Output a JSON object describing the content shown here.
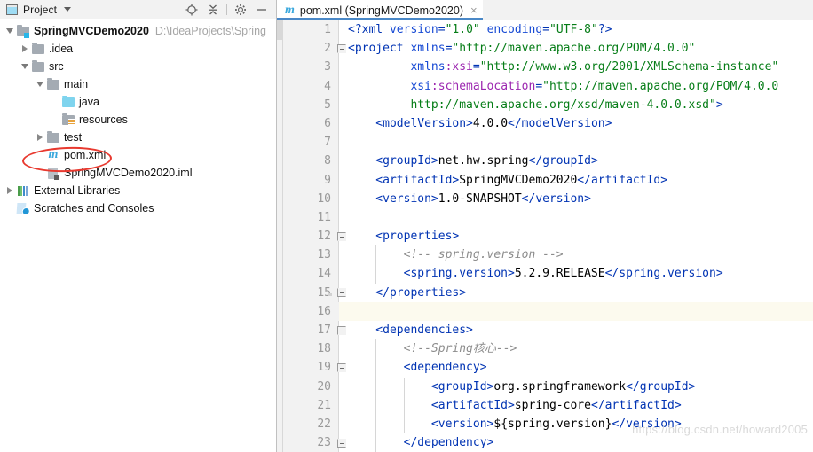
{
  "project_panel": {
    "header": {
      "title": "Project",
      "icon": "project-window-icon",
      "caret": "chevron-down-icon",
      "buttons": [
        {
          "name": "locate-icon",
          "tooltip": "Select Opened File"
        },
        {
          "name": "collapse-all-icon",
          "tooltip": "Collapse All"
        },
        {
          "name": "gear-icon",
          "tooltip": "Settings"
        },
        {
          "name": "minimize-icon",
          "tooltip": "Hide"
        }
      ]
    },
    "tree": [
      {
        "label": "SpringMVCDemo2020",
        "path": "D:\\IdeaProjects\\Spring",
        "indent": 0,
        "twisty": "down",
        "icon": "module-folder-icon",
        "bold": true
      },
      {
        "label": ".idea",
        "path": "",
        "indent": 1,
        "twisty": "right",
        "icon": "folder-icon",
        "bold": false
      },
      {
        "label": "src",
        "path": "",
        "indent": 1,
        "twisty": "down",
        "icon": "folder-icon",
        "bold": false
      },
      {
        "label": "main",
        "path": "",
        "indent": 2,
        "twisty": "down",
        "icon": "folder-icon",
        "bold": false
      },
      {
        "label": "java",
        "path": "",
        "indent": 3,
        "twisty": "none",
        "icon": "sources-folder-icon",
        "bold": false
      },
      {
        "label": "resources",
        "path": "",
        "indent": 3,
        "twisty": "none",
        "icon": "resources-folder-icon",
        "bold": false
      },
      {
        "label": "test",
        "path": "",
        "indent": 2,
        "twisty": "right",
        "icon": "folder-icon",
        "bold": false
      },
      {
        "label": "pom.xml",
        "path": "",
        "indent": 2,
        "twisty": "none",
        "icon": "maven-icon",
        "bold": false
      },
      {
        "label": "SpringMVCDemo2020.iml",
        "path": "",
        "indent": 2,
        "twisty": "none",
        "icon": "iml-file-icon",
        "bold": false
      },
      {
        "label": "External Libraries",
        "path": "",
        "indent": 0,
        "twisty": "right",
        "icon": "libraries-icon",
        "bold": false
      },
      {
        "label": "Scratches and Consoles",
        "path": "",
        "indent": 0,
        "twisty": "none",
        "icon": "scratches-icon",
        "bold": false
      }
    ],
    "annotation": {
      "shape": "ellipse",
      "color": "#e8392f",
      "target": "pom.xml"
    }
  },
  "editor": {
    "tab": {
      "icon": "maven-icon",
      "label": "pom.xml (SpringMVCDemo2020)",
      "close": "×"
    },
    "accent_color": "#4a88c7",
    "current_line": 16,
    "lines": [
      {
        "n": 1,
        "fold": "none",
        "bulb": false,
        "tokens": [
          {
            "c": "t",
            "s": "<?xml "
          },
          {
            "c": "a",
            "s": "version"
          },
          {
            "c": "t",
            "s": "="
          },
          {
            "c": "v",
            "s": "\"1.0\""
          },
          {
            "c": "t",
            "s": " "
          },
          {
            "c": "a",
            "s": "encoding"
          },
          {
            "c": "t",
            "s": "="
          },
          {
            "c": "v",
            "s": "\"UTF-8\""
          },
          {
            "c": "t",
            "s": "?>"
          }
        ],
        "indent": 4
      },
      {
        "n": 2,
        "fold": "open",
        "bulb": false,
        "tokens": [
          {
            "c": "t",
            "s": "<project "
          },
          {
            "c": "a",
            "s": "xmlns"
          },
          {
            "c": "t",
            "s": "="
          },
          {
            "c": "v",
            "s": "\"http://maven.apache.org/POM/4.0.0\""
          }
        ],
        "indent": 2
      },
      {
        "n": 3,
        "fold": "none",
        "bulb": false,
        "tokens": [
          {
            "c": "a",
            "s": "         xmlns"
          },
          {
            "c": "ns",
            "s": ":xsi"
          },
          {
            "c": "t",
            "s": "="
          },
          {
            "c": "v",
            "s": "\"http://www.w3.org/2001/XMLSchema-instance\""
          }
        ],
        "indent": 2
      },
      {
        "n": 4,
        "fold": "none",
        "bulb": false,
        "tokens": [
          {
            "c": "a",
            "s": "         xsi"
          },
          {
            "c": "ns",
            "s": ":schemaLocation"
          },
          {
            "c": "t",
            "s": "="
          },
          {
            "c": "v",
            "s": "\"http://maven.apache.org/POM/4.0.0"
          }
        ],
        "indent": 2
      },
      {
        "n": 5,
        "fold": "none",
        "bulb": false,
        "tokens": [
          {
            "c": "v",
            "s": "         http://maven.apache.org/xsd/maven-4.0.0.xsd\""
          },
          {
            "c": "t",
            "s": ">"
          }
        ],
        "indent": 2
      },
      {
        "n": 6,
        "fold": "none",
        "bulb": false,
        "tokens": [
          {
            "c": "t",
            "s": "    <modelVersion>"
          },
          {
            "c": "txt",
            "s": "4.0.0"
          },
          {
            "c": "t",
            "s": "</modelVersion>"
          }
        ],
        "indent": 4
      },
      {
        "n": 7,
        "fold": "none",
        "bulb": false,
        "tokens": [],
        "indent": 4
      },
      {
        "n": 8,
        "fold": "none",
        "bulb": false,
        "tokens": [
          {
            "c": "t",
            "s": "    <groupId>"
          },
          {
            "c": "txt",
            "s": "net.hw.spring"
          },
          {
            "c": "t",
            "s": "</groupId>"
          }
        ],
        "indent": 4
      },
      {
        "n": 9,
        "fold": "none",
        "bulb": false,
        "tokens": [
          {
            "c": "t",
            "s": "    <artifactId>"
          },
          {
            "c": "txt",
            "s": "SpringMVCDemo2020"
          },
          {
            "c": "t",
            "s": "</artifactId>"
          }
        ],
        "indent": 4
      },
      {
        "n": 10,
        "fold": "none",
        "bulb": false,
        "tokens": [
          {
            "c": "t",
            "s": "    <version>"
          },
          {
            "c": "txt",
            "s": "1.0-SNAPSHOT"
          },
          {
            "c": "t",
            "s": "</version>"
          }
        ],
        "indent": 4
      },
      {
        "n": 11,
        "fold": "none",
        "bulb": false,
        "tokens": [],
        "indent": 4
      },
      {
        "n": 12,
        "fold": "open",
        "bulb": false,
        "tokens": [
          {
            "c": "t",
            "s": "    <properties>"
          }
        ],
        "indent": 4
      },
      {
        "n": 13,
        "fold": "none",
        "bulb": false,
        "tokens": [
          {
            "c": "cm",
            "s": "        <!-- spring.version -->"
          }
        ],
        "indent": 4
      },
      {
        "n": 14,
        "fold": "none",
        "bulb": false,
        "tokens": [
          {
            "c": "t",
            "s": "        <spring.version>"
          },
          {
            "c": "txt",
            "s": "5.2.9.RELEASE"
          },
          {
            "c": "t",
            "s": "</spring.version>"
          }
        ],
        "indent": 4
      },
      {
        "n": 15,
        "fold": "close",
        "bulb": true,
        "tokens": [
          {
            "c": "t",
            "s": "    </properties>"
          }
        ],
        "indent": 4
      },
      {
        "n": 16,
        "fold": "none",
        "bulb": false,
        "tokens": [],
        "indent": 4
      },
      {
        "n": 17,
        "fold": "open",
        "bulb": false,
        "tokens": [
          {
            "c": "t",
            "s": "    <dependencies>"
          }
        ],
        "indent": 4
      },
      {
        "n": 18,
        "fold": "none",
        "bulb": false,
        "tokens": [
          {
            "c": "cm",
            "s": "        <!--Spring核心-->"
          }
        ],
        "indent": 4
      },
      {
        "n": 19,
        "fold": "open",
        "bulb": false,
        "tokens": [
          {
            "c": "t",
            "s": "        <dependency>"
          }
        ],
        "indent": 8
      },
      {
        "n": 20,
        "fold": "none",
        "bulb": false,
        "tokens": [
          {
            "c": "t",
            "s": "            <groupId>"
          },
          {
            "c": "txt",
            "s": "org.springframework"
          },
          {
            "c": "t",
            "s": "</groupId>"
          }
        ],
        "indent": 8
      },
      {
        "n": 21,
        "fold": "none",
        "bulb": false,
        "tokens": [
          {
            "c": "t",
            "s": "            <artifactId>"
          },
          {
            "c": "txt",
            "s": "spring-core"
          },
          {
            "c": "t",
            "s": "</artifactId>"
          }
        ],
        "indent": 8
      },
      {
        "n": 22,
        "fold": "none",
        "bulb": false,
        "tokens": [
          {
            "c": "t",
            "s": "            <version>"
          },
          {
            "c": "txt",
            "s": "${spring.version}"
          },
          {
            "c": "t",
            "s": "</version>"
          }
        ],
        "indent": 8
      },
      {
        "n": 23,
        "fold": "close",
        "bulb": false,
        "tokens": [
          {
            "c": "t",
            "s": "        </dependency>"
          }
        ],
        "indent": 8
      }
    ]
  },
  "watermark": "https://blog.csdn.net/howard2005"
}
